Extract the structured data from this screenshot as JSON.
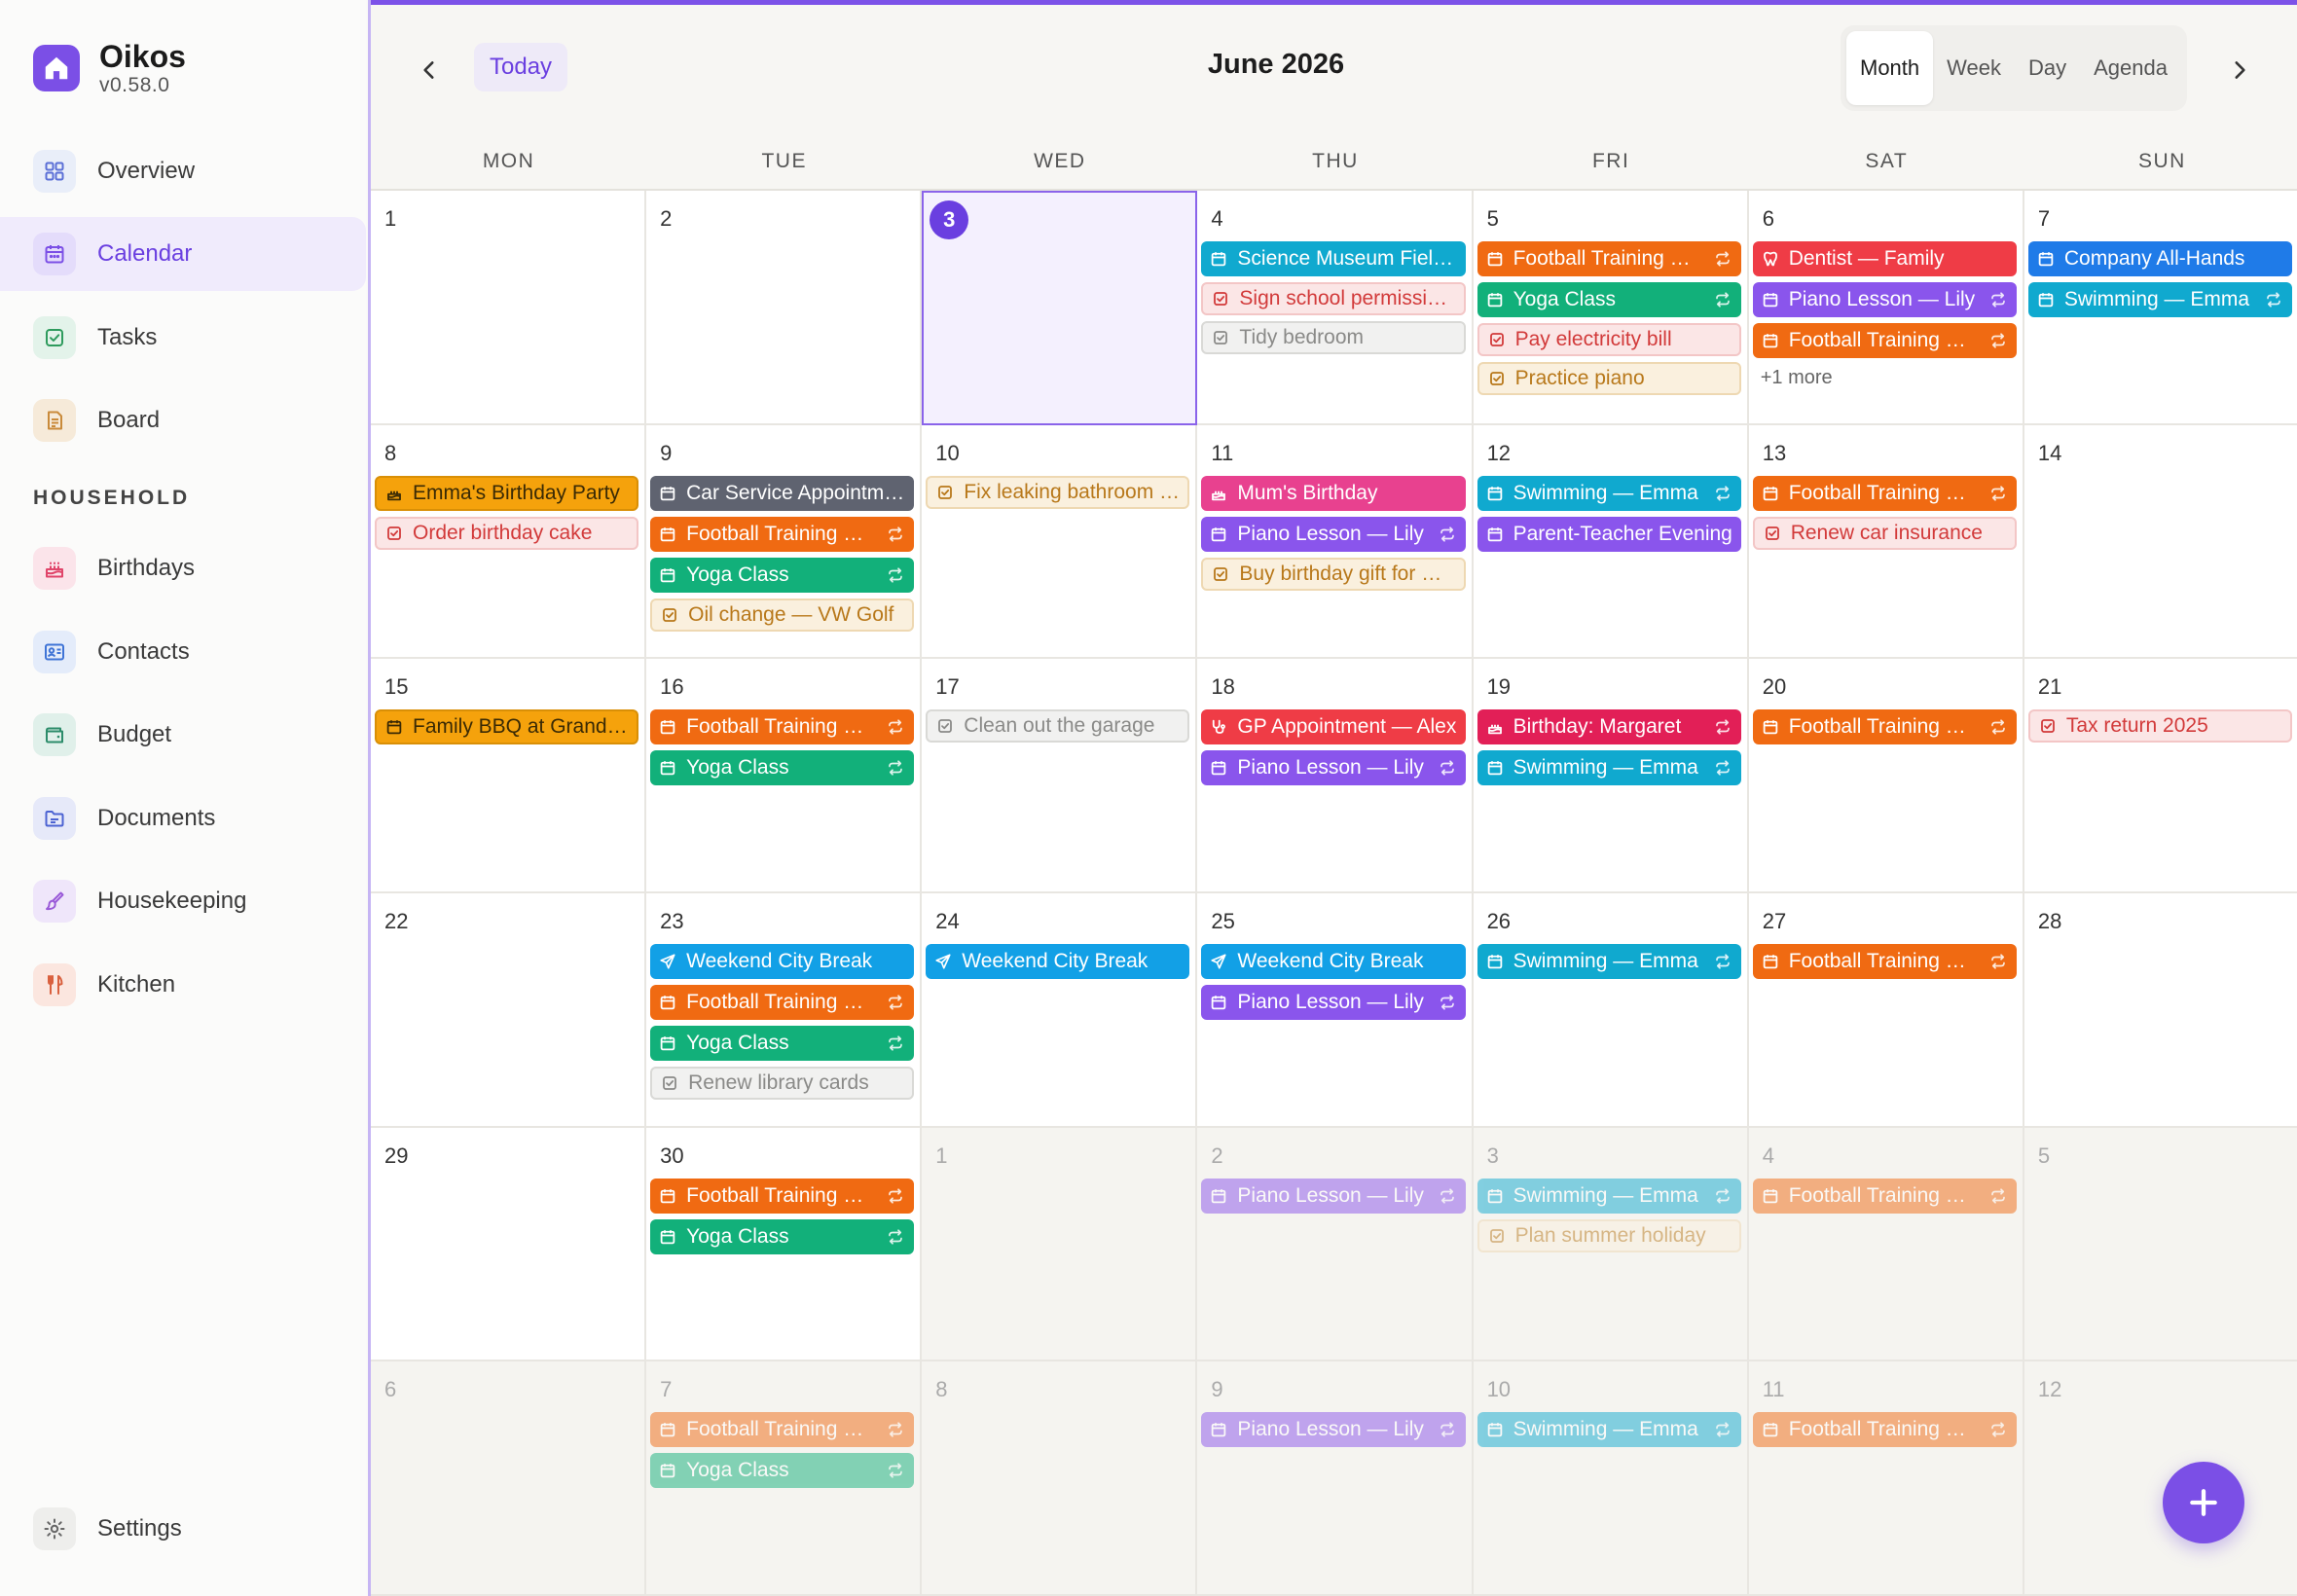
{
  "app": {
    "name": "Oikos",
    "version": "v0.58.0"
  },
  "nav": {
    "main": [
      {
        "label": "Overview",
        "icon": "grid-icon",
        "bg": "#e9eef9",
        "fg": "#5a6fd6"
      },
      {
        "label": "Calendar",
        "icon": "calendar-icon",
        "bg": "#e4dcfb",
        "fg": "#7b4fe6",
        "active": true
      },
      {
        "label": "Tasks",
        "icon": "checkbox-icon",
        "bg": "#e3f3ea",
        "fg": "#2e9b5d"
      },
      {
        "label": "Board",
        "icon": "note-icon",
        "bg": "#f6ead9",
        "fg": "#c98a3a"
      }
    ],
    "section_label": "HOUSEHOLD",
    "household": [
      {
        "label": "Birthdays",
        "icon": "cake-icon",
        "bg": "#fbe4ea",
        "fg": "#e0456a"
      },
      {
        "label": "Contacts",
        "icon": "contact-card-icon",
        "bg": "#e4ecfa",
        "fg": "#3f74d6"
      },
      {
        "label": "Budget",
        "icon": "wallet-icon",
        "bg": "#e0f0ea",
        "fg": "#2c8c6a"
      },
      {
        "label": "Documents",
        "icon": "folder-icon",
        "bg": "#e6e9f9",
        "fg": "#4c63d2"
      },
      {
        "label": "Housekeeping",
        "icon": "brush-icon",
        "bg": "#efe6fa",
        "fg": "#9a5ad8"
      },
      {
        "label": "Kitchen",
        "icon": "utensils-icon",
        "bg": "#fbe6df",
        "fg": "#d9603e"
      }
    ],
    "settings": {
      "label": "Settings",
      "icon": "gear-icon",
      "bg": "#eeeeec",
      "fg": "#666666"
    }
  },
  "toolbar": {
    "today_label": "Today",
    "title": "June 2026",
    "views": [
      {
        "label": "Month",
        "active": true
      },
      {
        "label": "Week"
      },
      {
        "label": "Day"
      },
      {
        "label": "Agenda"
      }
    ]
  },
  "weekdays": [
    "MON",
    "TUE",
    "WED",
    "THU",
    "FRI",
    "SAT",
    "SUN"
  ],
  "colors": {
    "orange": "#f06a12",
    "green": "#12b07a",
    "purple": "#8a55ec",
    "cyan": "#10a9cf",
    "blue": "#1f7be8",
    "red": "#ef3c46",
    "gray": "#5f6370",
    "amber": "#f5a20c",
    "pink": "#e8418f",
    "crimson": "#e21f57",
    "sky": "#12a0e6",
    "task_red_bg": "#fbe6e6",
    "task_red_bd": "#f3c6c6",
    "task_red_fg": "#d23a3a",
    "task_amber_bg": "#faf0de",
    "task_amber_bd": "#eed8b2",
    "task_amber_fg": "#b8781a",
    "task_gray_bg": "#f1f1f0",
    "task_gray_bd": "#d9d9d6",
    "task_gray_fg": "#8a8a88"
  },
  "weeks": [
    [
      {
        "day": "1",
        "events": []
      },
      {
        "day": "2",
        "events": []
      },
      {
        "day": "3",
        "today": true,
        "events": []
      },
      {
        "day": "4",
        "events": [
          {
            "title": "Science Museum Field Trip",
            "color": "cyan",
            "icon": "calendar"
          },
          {
            "title": "Sign school permission slip",
            "kind": "task",
            "tone": "red"
          },
          {
            "title": "Tidy bedroom",
            "kind": "task",
            "tone": "gray"
          }
        ]
      },
      {
        "day": "5",
        "events": [
          {
            "title": "Football Training — Jamie",
            "color": "orange",
            "icon": "calendar",
            "repeat": true
          },
          {
            "title": "Yoga Class",
            "color": "green",
            "icon": "calendar",
            "repeat": true
          },
          {
            "title": "Pay electricity bill",
            "kind": "task",
            "tone": "red"
          },
          {
            "title": "Practice piano",
            "kind": "task",
            "tone": "amber"
          }
        ]
      },
      {
        "day": "6",
        "more": "+1 more",
        "events": [
          {
            "title": "Dentist — Family",
            "color": "red",
            "icon": "tooth"
          },
          {
            "title": "Piano Lesson — Lily",
            "color": "purple",
            "icon": "calendar",
            "repeat": true
          },
          {
            "title": "Football Training — Jamie",
            "color": "orange",
            "icon": "calendar",
            "repeat": true
          }
        ]
      },
      {
        "day": "7",
        "events": [
          {
            "title": "Company All-Hands",
            "color": "blue",
            "icon": "calendar"
          },
          {
            "title": "Swimming — Emma",
            "color": "cyan",
            "icon": "calendar",
            "repeat": true
          }
        ]
      }
    ],
    [
      {
        "day": "8",
        "events": [
          {
            "title": "Emma's Birthday Party",
            "color": "amber",
            "icon": "cake",
            "dark": true
          },
          {
            "title": "Order birthday cake",
            "kind": "task",
            "tone": "red"
          }
        ]
      },
      {
        "day": "9",
        "events": [
          {
            "title": "Car Service Appointment",
            "color": "gray",
            "icon": "calendar"
          },
          {
            "title": "Football Training — Jamie",
            "color": "orange",
            "icon": "calendar",
            "repeat": true
          },
          {
            "title": "Yoga Class",
            "color": "green",
            "icon": "calendar",
            "repeat": true
          },
          {
            "title": "Oil change — VW Golf",
            "kind": "task",
            "tone": "amber"
          }
        ]
      },
      {
        "day": "10",
        "events": [
          {
            "title": "Fix leaking bathroom tap",
            "kind": "task",
            "tone": "amber"
          }
        ]
      },
      {
        "day": "11",
        "events": [
          {
            "title": "Mum's Birthday",
            "color": "pink",
            "icon": "cake"
          },
          {
            "title": "Piano Lesson — Lily",
            "color": "purple",
            "icon": "calendar",
            "repeat": true
          },
          {
            "title": "Buy birthday gift for Mum",
            "kind": "task",
            "tone": "amber"
          }
        ]
      },
      {
        "day": "12",
        "events": [
          {
            "title": "Swimming — Emma",
            "color": "cyan",
            "icon": "calendar",
            "repeat": true
          },
          {
            "title": "Parent-Teacher Evening",
            "color": "purple",
            "icon": "calendar"
          }
        ]
      },
      {
        "day": "13",
        "events": [
          {
            "title": "Football Training — Jamie",
            "color": "orange",
            "icon": "calendar",
            "repeat": true
          },
          {
            "title": "Renew car insurance",
            "kind": "task",
            "tone": "red"
          }
        ]
      },
      {
        "day": "14",
        "events": []
      }
    ],
    [
      {
        "day": "15",
        "events": [
          {
            "title": "Family BBQ at Grandma's",
            "color": "amber",
            "icon": "calendar",
            "dark": true
          }
        ]
      },
      {
        "day": "16",
        "events": [
          {
            "title": "Football Training — Jamie",
            "color": "orange",
            "icon": "calendar",
            "repeat": true
          },
          {
            "title": "Yoga Class",
            "color": "green",
            "icon": "calendar",
            "repeat": true
          }
        ]
      },
      {
        "day": "17",
        "events": [
          {
            "title": "Clean out the garage",
            "kind": "task",
            "tone": "gray"
          }
        ]
      },
      {
        "day": "18",
        "events": [
          {
            "title": "GP Appointment — Alex",
            "color": "red",
            "icon": "stethoscope"
          },
          {
            "title": "Piano Lesson — Lily",
            "color": "purple",
            "icon": "calendar",
            "repeat": true
          }
        ]
      },
      {
        "day": "19",
        "events": [
          {
            "title": "Birthday: Margaret",
            "color": "crimson",
            "icon": "cake",
            "repeat": true
          },
          {
            "title": "Swimming — Emma",
            "color": "cyan",
            "icon": "calendar",
            "repeat": true
          }
        ]
      },
      {
        "day": "20",
        "events": [
          {
            "title": "Football Training — Jamie",
            "color": "orange",
            "icon": "calendar",
            "repeat": true
          }
        ]
      },
      {
        "day": "21",
        "events": [
          {
            "title": "Tax return 2025",
            "kind": "task",
            "tone": "red"
          }
        ]
      }
    ],
    [
      {
        "day": "22",
        "events": []
      },
      {
        "day": "23",
        "events": [
          {
            "title": "Weekend City Break",
            "color": "sky",
            "icon": "plane"
          },
          {
            "title": "Football Training — Jamie",
            "color": "orange",
            "icon": "calendar",
            "repeat": true
          },
          {
            "title": "Yoga Class",
            "color": "green",
            "icon": "calendar",
            "repeat": true
          },
          {
            "title": "Renew library cards",
            "kind": "task",
            "tone": "gray"
          }
        ]
      },
      {
        "day": "24",
        "events": [
          {
            "title": "Weekend City Break",
            "color": "sky",
            "icon": "plane"
          }
        ]
      },
      {
        "day": "25",
        "events": [
          {
            "title": "Weekend City Break",
            "color": "sky",
            "icon": "plane"
          },
          {
            "title": "Piano Lesson — Lily",
            "color": "purple",
            "icon": "calendar",
            "repeat": true
          }
        ]
      },
      {
        "day": "26",
        "events": [
          {
            "title": "Swimming — Emma",
            "color": "cyan",
            "icon": "calendar",
            "repeat": true
          }
        ]
      },
      {
        "day": "27",
        "events": [
          {
            "title": "Football Training — Jamie",
            "color": "orange",
            "icon": "calendar",
            "repeat": true
          }
        ]
      },
      {
        "day": "28",
        "events": []
      }
    ],
    [
      {
        "day": "29",
        "events": []
      },
      {
        "day": "30",
        "events": [
          {
            "title": "Football Training — Jamie",
            "color": "orange",
            "icon": "calendar",
            "repeat": true
          },
          {
            "title": "Yoga Class",
            "color": "green",
            "icon": "calendar",
            "repeat": true
          }
        ]
      },
      {
        "day": "1",
        "outside": true,
        "events": []
      },
      {
        "day": "2",
        "outside": true,
        "events": [
          {
            "title": "Piano Lesson — Lily",
            "color": "purple",
            "icon": "calendar",
            "repeat": true
          }
        ]
      },
      {
        "day": "3",
        "outside": true,
        "events": [
          {
            "title": "Swimming — Emma",
            "color": "cyan",
            "icon": "calendar",
            "repeat": true
          },
          {
            "title": "Plan summer holiday",
            "kind": "task",
            "tone": "amber"
          }
        ]
      },
      {
        "day": "4",
        "outside": true,
        "events": [
          {
            "title": "Football Training — Jamie",
            "color": "orange",
            "icon": "calendar",
            "repeat": true
          }
        ]
      },
      {
        "day": "5",
        "outside": true,
        "events": []
      }
    ],
    [
      {
        "day": "6",
        "outside": true,
        "events": []
      },
      {
        "day": "7",
        "outside": true,
        "events": [
          {
            "title": "Football Training — Jamie",
            "color": "orange",
            "icon": "calendar",
            "repeat": true
          },
          {
            "title": "Yoga Class",
            "color": "green",
            "icon": "calendar",
            "repeat": true
          }
        ]
      },
      {
        "day": "8",
        "outside": true,
        "events": []
      },
      {
        "day": "9",
        "outside": true,
        "events": [
          {
            "title": "Piano Lesson — Lily",
            "color": "purple",
            "icon": "calendar",
            "repeat": true
          }
        ]
      },
      {
        "day": "10",
        "outside": true,
        "events": [
          {
            "title": "Swimming — Emma",
            "color": "cyan",
            "icon": "calendar",
            "repeat": true
          }
        ]
      },
      {
        "day": "11",
        "outside": true,
        "events": [
          {
            "title": "Football Training — Jamie",
            "color": "orange",
            "icon": "calendar",
            "repeat": true
          }
        ]
      },
      {
        "day": "12",
        "outside": true,
        "events": []
      }
    ]
  ],
  "fab": {
    "icon": "plus-icon",
    "color": "#7b4fe6"
  }
}
